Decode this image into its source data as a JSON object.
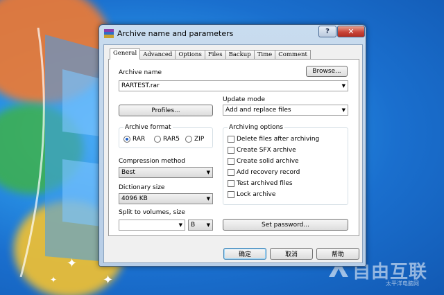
{
  "window": {
    "title": "Archive name and parameters",
    "help_label": "?",
    "close_label": "✕"
  },
  "tabs": [
    {
      "label": "General",
      "active": true
    },
    {
      "label": "Advanced",
      "active": false
    },
    {
      "label": "Options",
      "active": false
    },
    {
      "label": "Files",
      "active": false
    },
    {
      "label": "Backup",
      "active": false
    },
    {
      "label": "Time",
      "active": false
    },
    {
      "label": "Comment",
      "active": false
    }
  ],
  "general": {
    "archive_name_label": "Archive name",
    "browse_label": "Browse...",
    "archive_name_value": "RARTEST.rar",
    "profiles_label": "Profiles...",
    "update_mode_label": "Update mode",
    "update_mode_value": "Add and replace files",
    "archive_format": {
      "title": "Archive format",
      "options": [
        "RAR",
        "RAR5",
        "ZIP"
      ],
      "selected": "RAR"
    },
    "compression_method_label": "Compression method",
    "compression_method_value": "Best",
    "dictionary_size_label": "Dictionary size",
    "dictionary_size_value": "4096 KB",
    "split_label": "Split to volumes, size",
    "split_value": "",
    "split_unit_value": "B",
    "archiving_options": {
      "title": "Archiving options",
      "items": [
        {
          "label": "Delete files after archiving",
          "checked": false
        },
        {
          "label": "Create SFX archive",
          "checked": false
        },
        {
          "label": "Create solid archive",
          "checked": false
        },
        {
          "label": "Add recovery record",
          "checked": false
        },
        {
          "label": "Test archived files",
          "checked": false
        },
        {
          "label": "Lock archive",
          "checked": false
        }
      ]
    },
    "set_password_label": "Set password..."
  },
  "buttons": {
    "ok": "确定",
    "cancel": "取消",
    "help": "帮助"
  },
  "watermark": {
    "brand": "自由互联",
    "sub": "太平洋电脑网"
  },
  "colors": {
    "desktop_blue": "#1b7fd6",
    "close_red": "#c9453a",
    "radio_selected": "#1d5ec8"
  }
}
